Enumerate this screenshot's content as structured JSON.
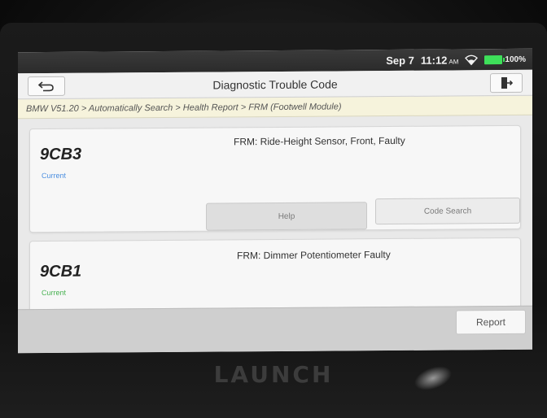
{
  "status_bar": {
    "date": "Sep 7",
    "time": "11:12",
    "ampm": "AM",
    "battery": "100%",
    "battery_color": "#3ee05a"
  },
  "title_bar": {
    "title": "Diagnostic Trouble Code",
    "back_icon": "back-arrow-icon",
    "exit_icon": "exit-icon"
  },
  "breadcrumb": "BMW V51.20 > Automatically Search > Health Report > FRM (Footwell Module)",
  "dtcs": [
    {
      "code": "9CB3",
      "status": "Current",
      "status_color": "#4a8ee0",
      "description": "FRM: Ride-Height Sensor, Front, Faulty",
      "buttons": {
        "help": "Help",
        "code_search": "Code Search"
      }
    },
    {
      "code": "9CB1",
      "status": "Current",
      "status_color": "#45b04f",
      "description": "FRM: Dimmer Potentiometer Faulty"
    }
  ],
  "footer": {
    "report": "Report"
  },
  "device_brand": "LAUNCH"
}
